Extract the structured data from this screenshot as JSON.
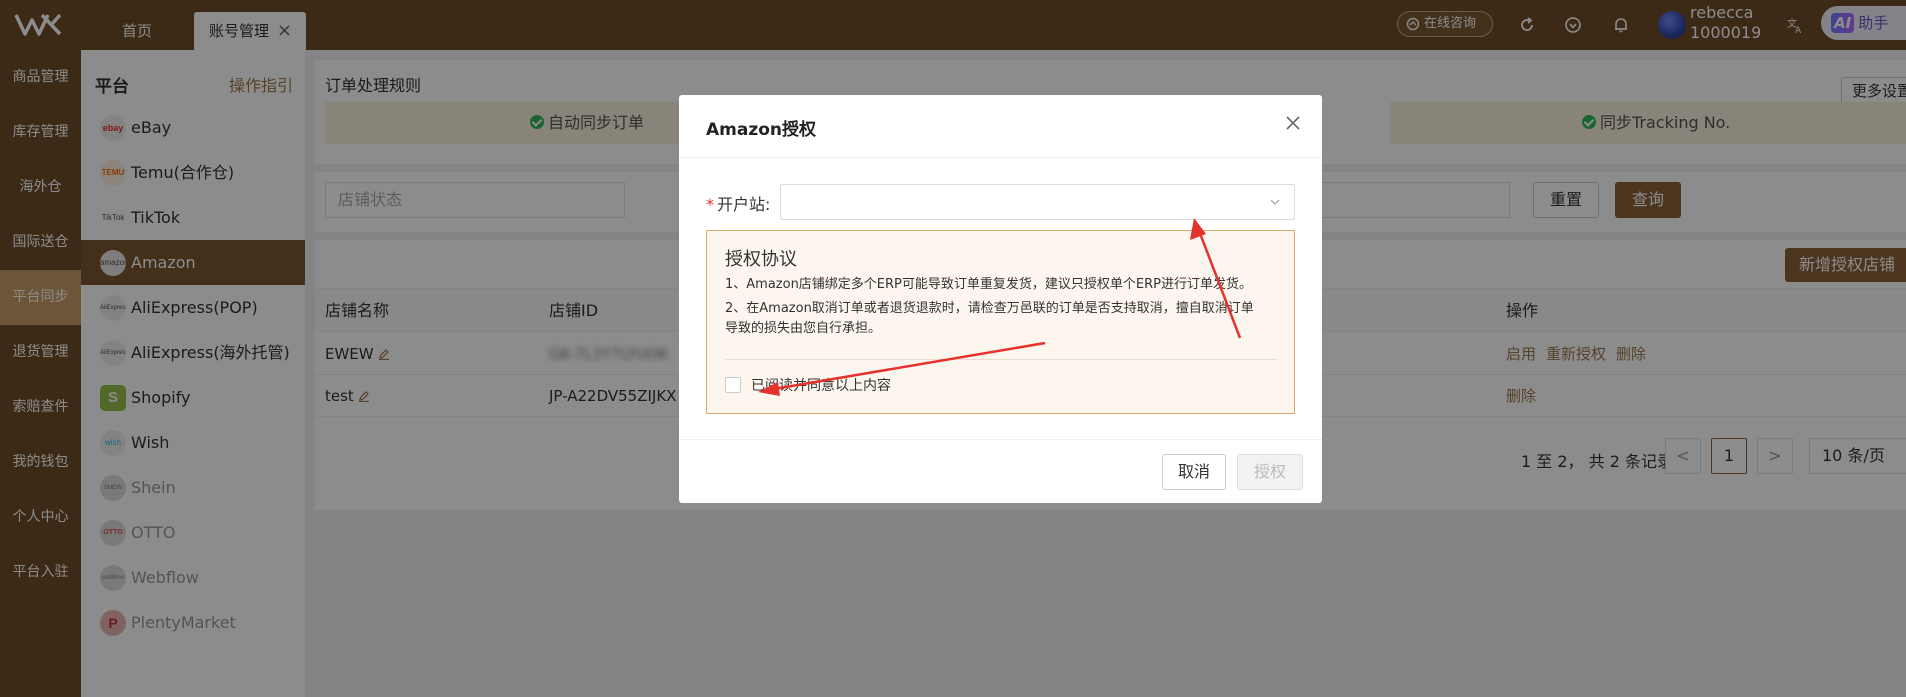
{
  "topbar": {
    "tabs": [
      {
        "label": "首页"
      },
      {
        "label": "账号管理"
      }
    ],
    "consult_label": "在线咨询",
    "user_name": "rebecca",
    "user_id": "1000019",
    "ai_badge": "AI",
    "ai_label": "助手"
  },
  "nav": {
    "items": [
      {
        "label": "商品管理"
      },
      {
        "label": "库存管理"
      },
      {
        "label": "海外仓"
      },
      {
        "label": "国际送仓"
      },
      {
        "label": "平台同步"
      },
      {
        "label": "退货管理"
      },
      {
        "label": "索赔查件"
      },
      {
        "label": "我的钱包"
      },
      {
        "label": "个人中心"
      },
      {
        "label": "平台入驻"
      }
    ],
    "active_index": 4
  },
  "platforms": {
    "title": "平台",
    "guide": "操作指引",
    "items": [
      {
        "label": "eBay",
        "icon": "ebay"
      },
      {
        "label": "Temu(合作仓)",
        "icon": "TEMU"
      },
      {
        "label": "TikTok",
        "icon": "TikTok"
      },
      {
        "label": "Amazon",
        "icon": "amazon"
      },
      {
        "label": "AliExpress(POP)",
        "icon": "AliExpress"
      },
      {
        "label": "AliExpress(海外托管)",
        "icon": "AliExpress"
      },
      {
        "label": "Shopify",
        "icon": "S"
      },
      {
        "label": "Wish",
        "icon": "wish"
      },
      {
        "label": "Shein",
        "icon": "SHEIN"
      },
      {
        "label": "OTTO",
        "icon": "OTTO"
      },
      {
        "label": "Webflow",
        "icon": "webflow"
      },
      {
        "label": "PlentyMarket",
        "icon": "P"
      }
    ]
  },
  "main": {
    "rules_title": "订单处理规则",
    "more_settings": "更多设置",
    "banners": [
      {
        "label": "自动同步订单"
      },
      {
        "label": "同步Tracking No."
      }
    ],
    "shop_status_placeholder": "店铺状态",
    "reset_label": "重置",
    "query_label": "查询",
    "new_auth_label": "新增授权店铺",
    "table": {
      "headers": [
        "店铺名称",
        "店铺ID",
        "操作"
      ],
      "rows": [
        {
          "name": "EWEW",
          "id": "GK-7L3Y7LYUOK",
          "ops": [
            "启用",
            "重新授权",
            "删除"
          ]
        },
        {
          "name": "test",
          "id": "JP-A22DV55ZIJKX",
          "ops": [
            "删除"
          ]
        }
      ]
    },
    "pager": {
      "info": "1 至 2， 共 2 条记录",
      "prev": "<",
      "current": "1",
      "next": ">",
      "page_size": "10 条/页"
    }
  },
  "modal": {
    "title": "Amazon授权",
    "site_required_mark": "*",
    "site_label": "开户站:",
    "site_value": "",
    "agreement": {
      "title": "授权协议",
      "line1": "1、Amazon店铺绑定多个ERP可能导致订单重复发货，建议只授权单个ERP进行订单发货。",
      "line2a": "2、在Amazon取消订单或者退货退款时，请检查万邑联的订单是否支持取消，擅自取消订单",
      "line2b": "导致的损失由您自行承担。",
      "checkbox_label": "已阅读并同意以上内容"
    },
    "cancel_label": "取消",
    "auth_label": "授权"
  },
  "colors": {
    "brand": "#6e4d28",
    "accent": "#8a6237",
    "nav_active": "#c79b64",
    "annotation_arrow": "#e5322d"
  }
}
